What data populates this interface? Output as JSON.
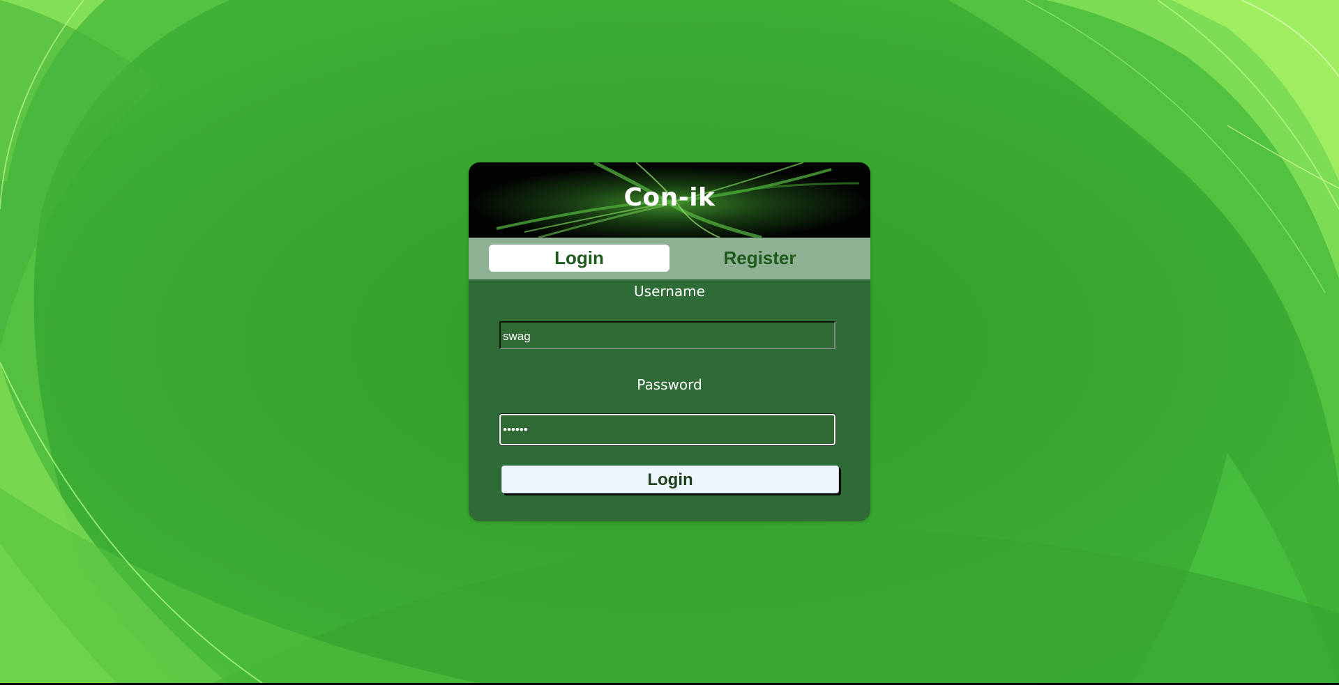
{
  "app": {
    "title": "Con-ik"
  },
  "tabs": [
    {
      "label": "Login",
      "active": true
    },
    {
      "label": "Register",
      "active": false
    }
  ],
  "form": {
    "username_label": "Username",
    "username_value": "swag",
    "password_label": "Password",
    "password_mask": "••••••",
    "submit_label": "Login"
  },
  "colors": {
    "background_green": "#3aa832",
    "card_green": "#2e6b36",
    "tab_bar": "#8fb193",
    "tab_text": "#1f5a1c",
    "button_bg": "#edf5fd"
  }
}
